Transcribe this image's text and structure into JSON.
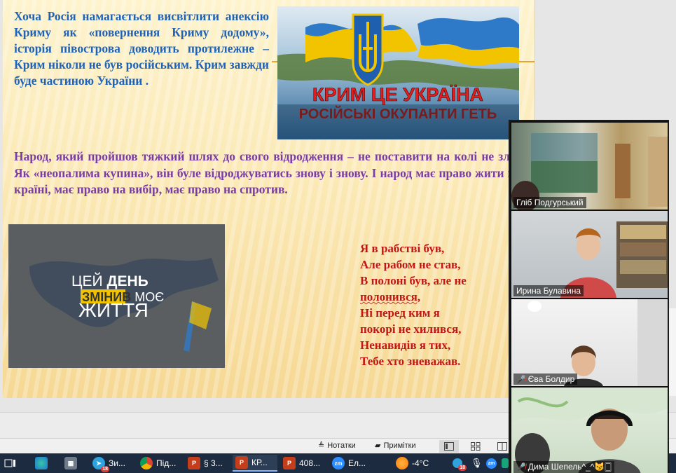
{
  "slide": {
    "paragraph_blue": "Хоча Росія намагається висвітлити анексію Криму як «повернення Криму додому», історія півострова доводить протилежне – Крим ніколи не був російським. Крим завжди буде частиною України .",
    "paragraph_purple": "Народ, який пройшов тяжкий шлях до свого відродження – не поставити на колі не зламати. Як «неопалима купина», він буле відроджуватись знову і знову. І народ має право жити в своїй країні, має право на вибір, має право на спротив.",
    "poem": [
      "Я в рабстві був,",
      "Але рабом не став,",
      "В полоні був, але не",
      "полонився,",
      "Ні перед ким я",
      "покорі не хилився,",
      "Ненавидів я тих,",
      "Тебе хто зневажав."
    ],
    "image_crimea": {
      "line1": "КРИМ ЦЕ УКРАЇНА",
      "line2": "РОСІЙСЬКІ ОКУПАНТИ ГЕТЬ"
    },
    "image_day": {
      "line1a": "ЦЕЙ ",
      "line1b": "ДЕНЬ",
      "line2a": "ЗМІНИВ",
      "line2b": " МОЄ",
      "line3": "ЖИТТЯ"
    }
  },
  "statusbar": {
    "notes_label": "Нотатки",
    "comments_label": "Примітки"
  },
  "participants": [
    {
      "name": "Гліб Подгурський",
      "muted": false
    },
    {
      "name": "Ирина Булавина",
      "muted": false
    },
    {
      "name": "Єва Болдир",
      "muted": true
    },
    {
      "name": "Дима Шепель^_^😼🀆",
      "muted": true
    }
  ],
  "taskbar": {
    "items": [
      {
        "label": "Зи...",
        "icon": "telegram-icon",
        "badge": "18"
      },
      {
        "label": "Під...",
        "icon": "chrome-icon"
      },
      {
        "label": "§ 3...",
        "icon": "powerpoint-icon"
      },
      {
        "label": "КР...",
        "icon": "powerpoint-icon"
      },
      {
        "label": "408...",
        "icon": "powerpoint-icon"
      },
      {
        "label": "Ел...",
        "icon": "zoom-icon"
      }
    ],
    "weather": "-4°C",
    "tray_badge": "18"
  },
  "colors": {
    "slide_blue": "#1f63b8",
    "slide_purple": "#7a3da6",
    "slide_red": "#c31516",
    "taskbar": "#1c2b3f"
  }
}
